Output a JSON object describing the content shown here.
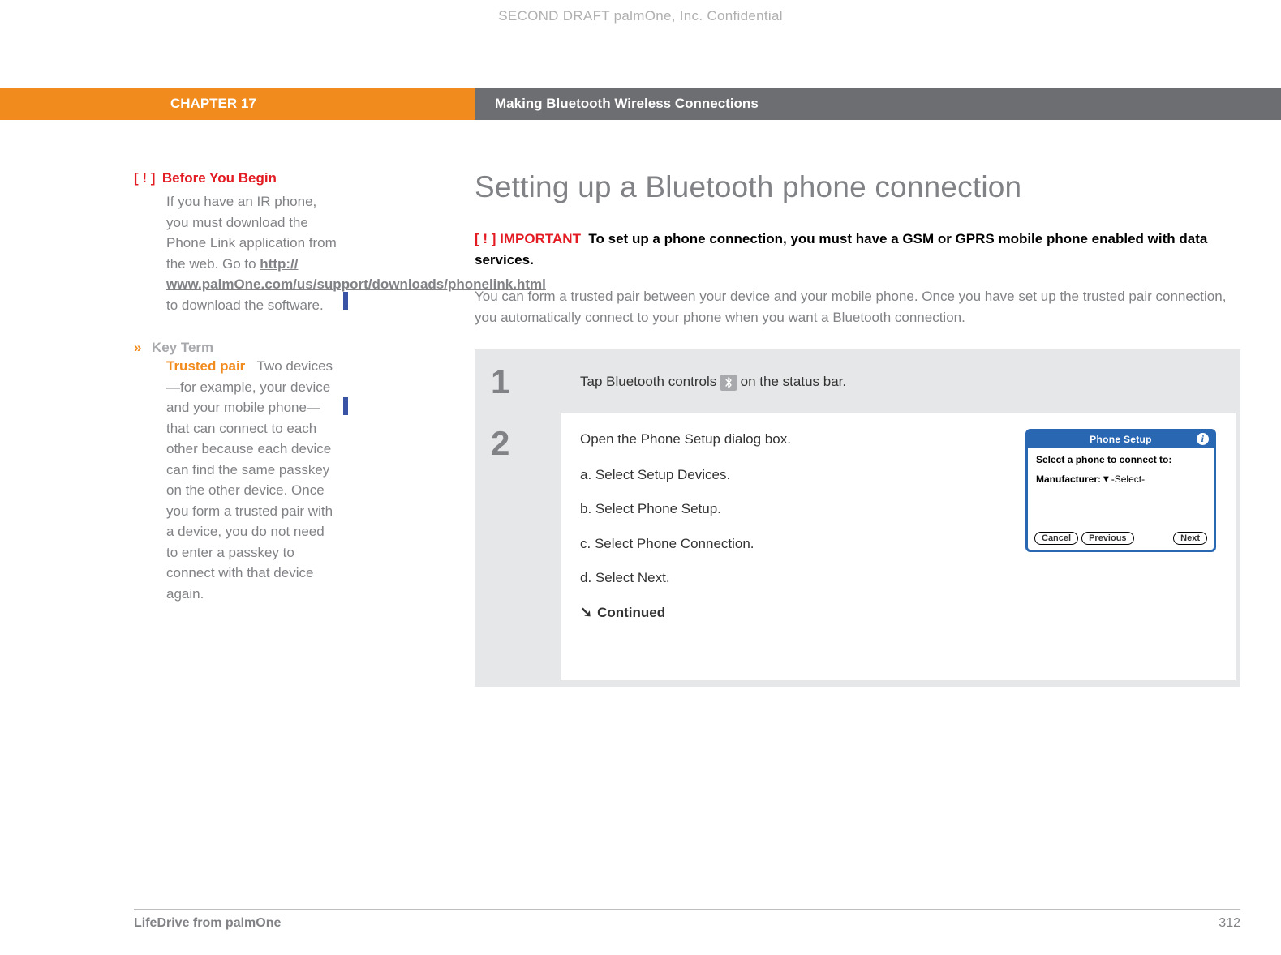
{
  "watermark": "SECOND DRAFT palmOne, Inc.  Confidential",
  "header": {
    "chapter": "CHAPTER 17",
    "title": "Making Bluetooth Wireless Connections"
  },
  "sidebar": {
    "byb": {
      "marker": "[ ! ]",
      "title": "Before You Begin",
      "body_pre": "If you have an IR phone, you must download the Phone Link application from the web. Go to ",
      "link": "http://\nwww.palmOne.com/us/support/downloads/phonelink.html",
      "body_post": " to download the software."
    },
    "keyterm": {
      "marker": "»",
      "label": "Key Term",
      "term": "Trusted pair",
      "definition": "Two devices—for example, your device and your mobile phone—that can connect to each other because each device can find the same passkey on the other device. Once you form a trusted pair with a device, you do not need to enter a passkey to connect with that device again."
    }
  },
  "main": {
    "heading": "Setting up a Bluetooth phone connection",
    "important": {
      "marker": "[ ! ]",
      "label": "IMPORTANT",
      "text": "To set up a phone connection, you must have a GSM or GPRS mobile phone enabled with data services."
    },
    "intro": "You can form a trusted pair between your device and your mobile phone. Once you have set up the trusted pair connection, you automatically connect to your phone when you want a Bluetooth connection.",
    "steps": [
      {
        "num": "1",
        "text_pre": "Tap Bluetooth controls ",
        "icon": "bluetooth-icon",
        "text_post": " on the status bar."
      },
      {
        "num": "2",
        "intro": "Open the Phone Setup dialog box.",
        "substeps": [
          "a.  Select Setup Devices.",
          "b.  Select Phone Setup.",
          "c.  Select Phone Connection.",
          "d.  Select Next."
        ],
        "continued": "Continued",
        "dialog": {
          "title": "Phone Setup",
          "prompt": "Select a phone to connect to:",
          "mfr_label": "Manufacturer:",
          "mfr_value": "-Select-",
          "buttons": {
            "cancel": "Cancel",
            "prev": "Previous",
            "next": "Next"
          }
        }
      }
    ]
  },
  "footer": {
    "product": "LifeDrive from palmOne",
    "page": "312"
  }
}
